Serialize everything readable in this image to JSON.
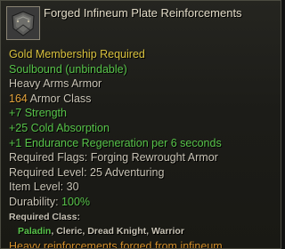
{
  "item": {
    "name": "Forged Infineum Plate Reinforcements",
    "icon": "armor-plate-icon"
  },
  "lines": {
    "membership": "Gold Membership Required",
    "soulbound": "Soulbound (unbindable)",
    "armor_type": "Heavy Arms Armor",
    "armor_class_value": "164",
    "armor_class_label": " Armor Class",
    "strength": "+7 Strength",
    "cold_absorption": "+25 Cold Absorption",
    "endurance_regen": "+1 Endurance Regeneration per 6 seconds",
    "required_flags": "Required Flags: Forging Rewrought Armor",
    "required_level": "Required Level: 25 Adventuring",
    "item_level": "Item Level: 30",
    "durability_label": "Durability: ",
    "durability_value": "100%",
    "required_class_label": "Required Class:",
    "class_first": "Paladin",
    "classes_rest": ", Cleric, Dread Knight, Warrior",
    "description": "Heavy reinforcements forged from infineum."
  },
  "colors": {
    "gold": "#d9c23e",
    "green": "#58c44a",
    "orange": "#e2a23b",
    "description": "#d4902c",
    "text": "#c8c3b5"
  }
}
